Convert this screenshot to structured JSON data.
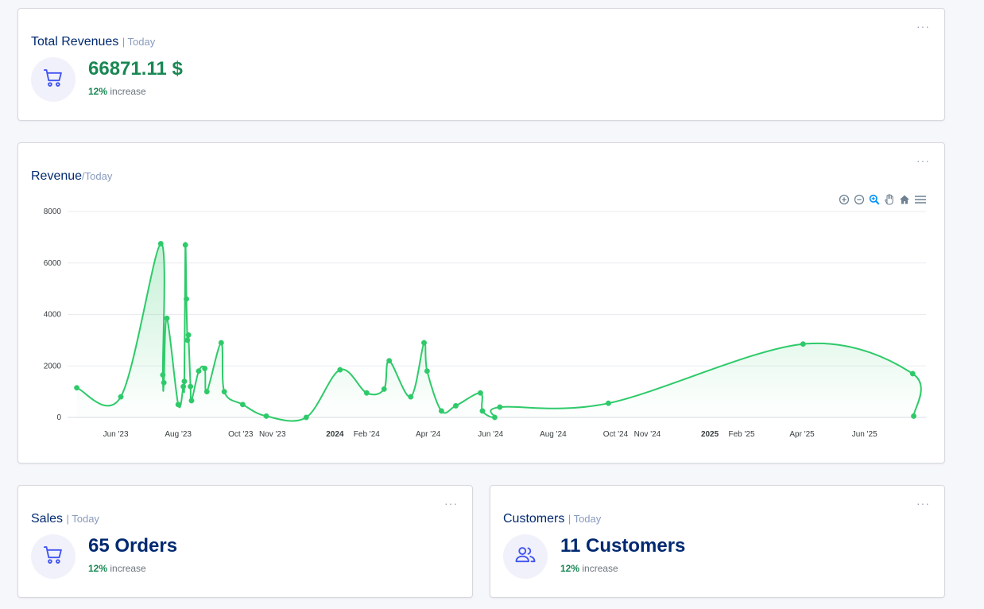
{
  "revenue_card": {
    "title": "Total Revenues",
    "filter": "| Today",
    "value": "66871.11 $",
    "pct": "12%",
    "pct_label": "increase",
    "menu": "···"
  },
  "chart_card": {
    "title": "Revenue",
    "filter": "/Today",
    "menu": "···"
  },
  "sales_card": {
    "title": "Sales",
    "filter": "| Today",
    "value": "65 Orders",
    "pct": "12%",
    "pct_label": "increase",
    "menu": "···"
  },
  "customers_card": {
    "title": "Customers",
    "filter": "| Today",
    "value": "11 Customers",
    "pct": "12%",
    "pct_label": "increase",
    "menu": "···"
  },
  "colors": {
    "navy": "#012970",
    "green_value": "#198754",
    "series_line": "#2eca6a",
    "icon_blue": "#4154f1"
  },
  "chart_data": {
    "type": "area",
    "title": "",
    "xlabel": "",
    "ylabel": "",
    "ylim": [
      0,
      8000
    ],
    "yticks": [
      "8000",
      "6000",
      "4000",
      "2000",
      "0"
    ],
    "xlim": [
      "2023-04-15",
      "2025-07-31"
    ],
    "xticks": [
      {
        "label": "Jun '23",
        "date": "2023-06-01",
        "bold": false
      },
      {
        "label": "Aug '23",
        "date": "2023-08-01",
        "bold": false
      },
      {
        "label": "Oct '23",
        "date": "2023-10-01",
        "bold": false
      },
      {
        "label": "Nov '23",
        "date": "2023-11-01",
        "bold": false
      },
      {
        "label": "2024",
        "date": "2024-01-01",
        "bold": true
      },
      {
        "label": "Feb '24",
        "date": "2024-02-01",
        "bold": false
      },
      {
        "label": "Apr '24",
        "date": "2024-04-01",
        "bold": false
      },
      {
        "label": "Jun '24",
        "date": "2024-06-01",
        "bold": false
      },
      {
        "label": "Aug '24",
        "date": "2024-08-01",
        "bold": false
      },
      {
        "label": "Oct '24",
        "date": "2024-10-01",
        "bold": false
      },
      {
        "label": "Nov '24",
        "date": "2024-11-01",
        "bold": false
      },
      {
        "label": "2025",
        "date": "2025-01-01",
        "bold": true
      },
      {
        "label": "Feb '25",
        "date": "2025-02-01",
        "bold": false
      },
      {
        "label": "Apr '25",
        "date": "2025-04-01",
        "bold": false
      },
      {
        "label": "Jun '25",
        "date": "2025-06-01",
        "bold": false
      }
    ],
    "grid": true,
    "legend": "none",
    "series": [
      {
        "points": [
          {
            "x": "2023-04-24",
            "y": 1150
          },
          {
            "x": "2023-06-06",
            "y": 800
          },
          {
            "x": "2023-07-15",
            "y": 6750
          },
          {
            "x": "2023-07-17",
            "y": 1650
          },
          {
            "x": "2023-07-18",
            "y": 1350
          },
          {
            "x": "2023-07-21",
            "y": 3850
          },
          {
            "x": "2023-08-01",
            "y": 500
          },
          {
            "x": "2023-08-06",
            "y": 1200
          },
          {
            "x": "2023-08-07",
            "y": 1400
          },
          {
            "x": "2023-08-08",
            "y": 6700
          },
          {
            "x": "2023-08-09",
            "y": 4600
          },
          {
            "x": "2023-08-10",
            "y": 3000
          },
          {
            "x": "2023-08-11",
            "y": 3200
          },
          {
            "x": "2023-08-13",
            "y": 1200
          },
          {
            "x": "2023-08-14",
            "y": 650
          },
          {
            "x": "2023-08-21",
            "y": 1800
          },
          {
            "x": "2023-08-27",
            "y": 1900
          },
          {
            "x": "2023-08-29",
            "y": 1000
          },
          {
            "x": "2023-09-12",
            "y": 2900
          },
          {
            "x": "2023-09-15",
            "y": 1000
          },
          {
            "x": "2023-10-03",
            "y": 500
          },
          {
            "x": "2023-10-26",
            "y": 50
          },
          {
            "x": "2023-12-04",
            "y": 0
          },
          {
            "x": "2024-01-06",
            "y": 1850
          },
          {
            "x": "2024-02-01",
            "y": 950
          },
          {
            "x": "2024-02-18",
            "y": 1100
          },
          {
            "x": "2024-02-23",
            "y": 2200
          },
          {
            "x": "2024-03-15",
            "y": 800
          },
          {
            "x": "2024-03-28",
            "y": 2900
          },
          {
            "x": "2024-03-31",
            "y": 1800
          },
          {
            "x": "2024-04-14",
            "y": 250
          },
          {
            "x": "2024-04-28",
            "y": 450
          },
          {
            "x": "2024-05-22",
            "y": 950
          },
          {
            "x": "2024-05-24",
            "y": 250
          },
          {
            "x": "2024-06-05",
            "y": 0
          },
          {
            "x": "2024-06-10",
            "y": 400
          },
          {
            "x": "2024-09-24",
            "y": 550
          },
          {
            "x": "2025-04-02",
            "y": 2850
          },
          {
            "x": "2025-07-18",
            "y": 1700
          },
          {
            "x": "2025-07-19",
            "y": 50
          }
        ]
      }
    ]
  }
}
